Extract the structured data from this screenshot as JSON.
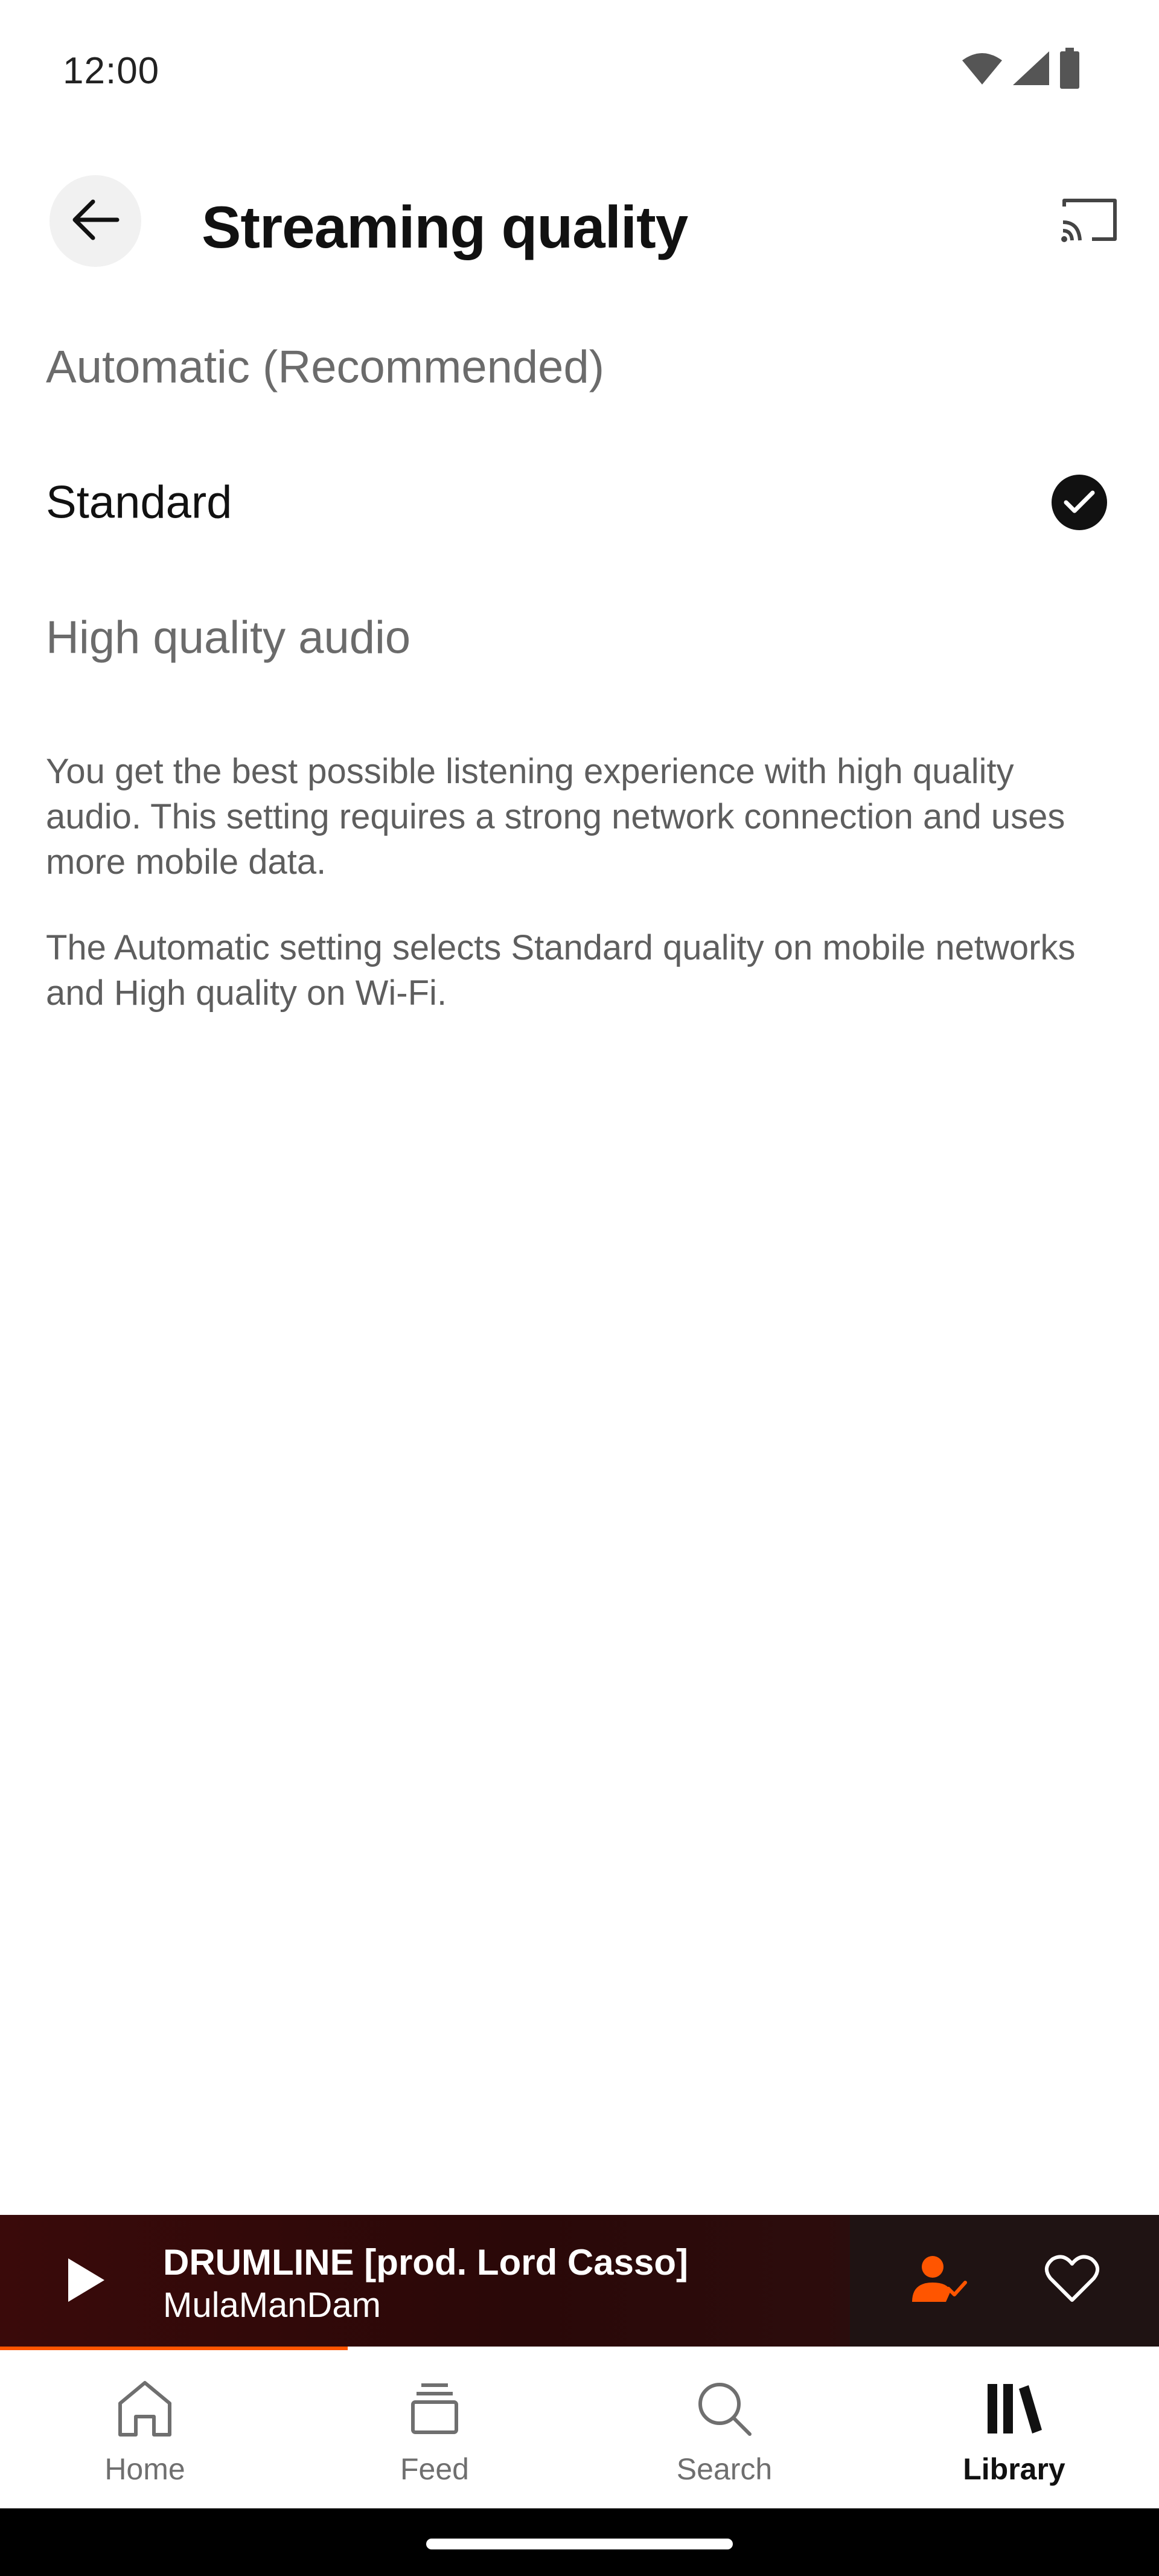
{
  "status_bar": {
    "time": "12:00",
    "icons": [
      "wifi-icon",
      "cellular-signal-icon",
      "battery-icon"
    ]
  },
  "header": {
    "title": "Streaming quality",
    "back_icon": "arrow-left-icon",
    "cast_icon": "cast-icon"
  },
  "options": [
    {
      "label": "Automatic (Recommended)",
      "selected": false
    },
    {
      "label": "Standard",
      "selected": true
    },
    {
      "label": "High quality audio",
      "selected": false
    }
  ],
  "description": {
    "paragraph1": "You get the best possible listening experience with high quality audio. This setting requires a strong network connection and uses more mobile data.",
    "paragraph2": "The Automatic setting selects Standard quality on mobile networks and High quality on Wi-Fi."
  },
  "mini_player": {
    "track_title": "DRUMLINE [prod. Lord Casso]",
    "artist": "MulaManDam",
    "progress_fraction": 0.3,
    "play_icon": "play-icon",
    "follow_icon": "user-following-icon",
    "like_icon": "heart-icon"
  },
  "bottom_nav": {
    "items": [
      {
        "label": "Home",
        "icon": "home-icon",
        "active": false
      },
      {
        "label": "Feed",
        "icon": "feed-icon",
        "active": false
      },
      {
        "label": "Search",
        "icon": "search-icon",
        "active": false
      },
      {
        "label": "Library",
        "icon": "library-icon",
        "active": true
      }
    ]
  },
  "colors": {
    "accent": "#ff5500",
    "player_bg": "#2a0808",
    "selected_check": "#111111",
    "muted_text": "#6b6b6b"
  }
}
